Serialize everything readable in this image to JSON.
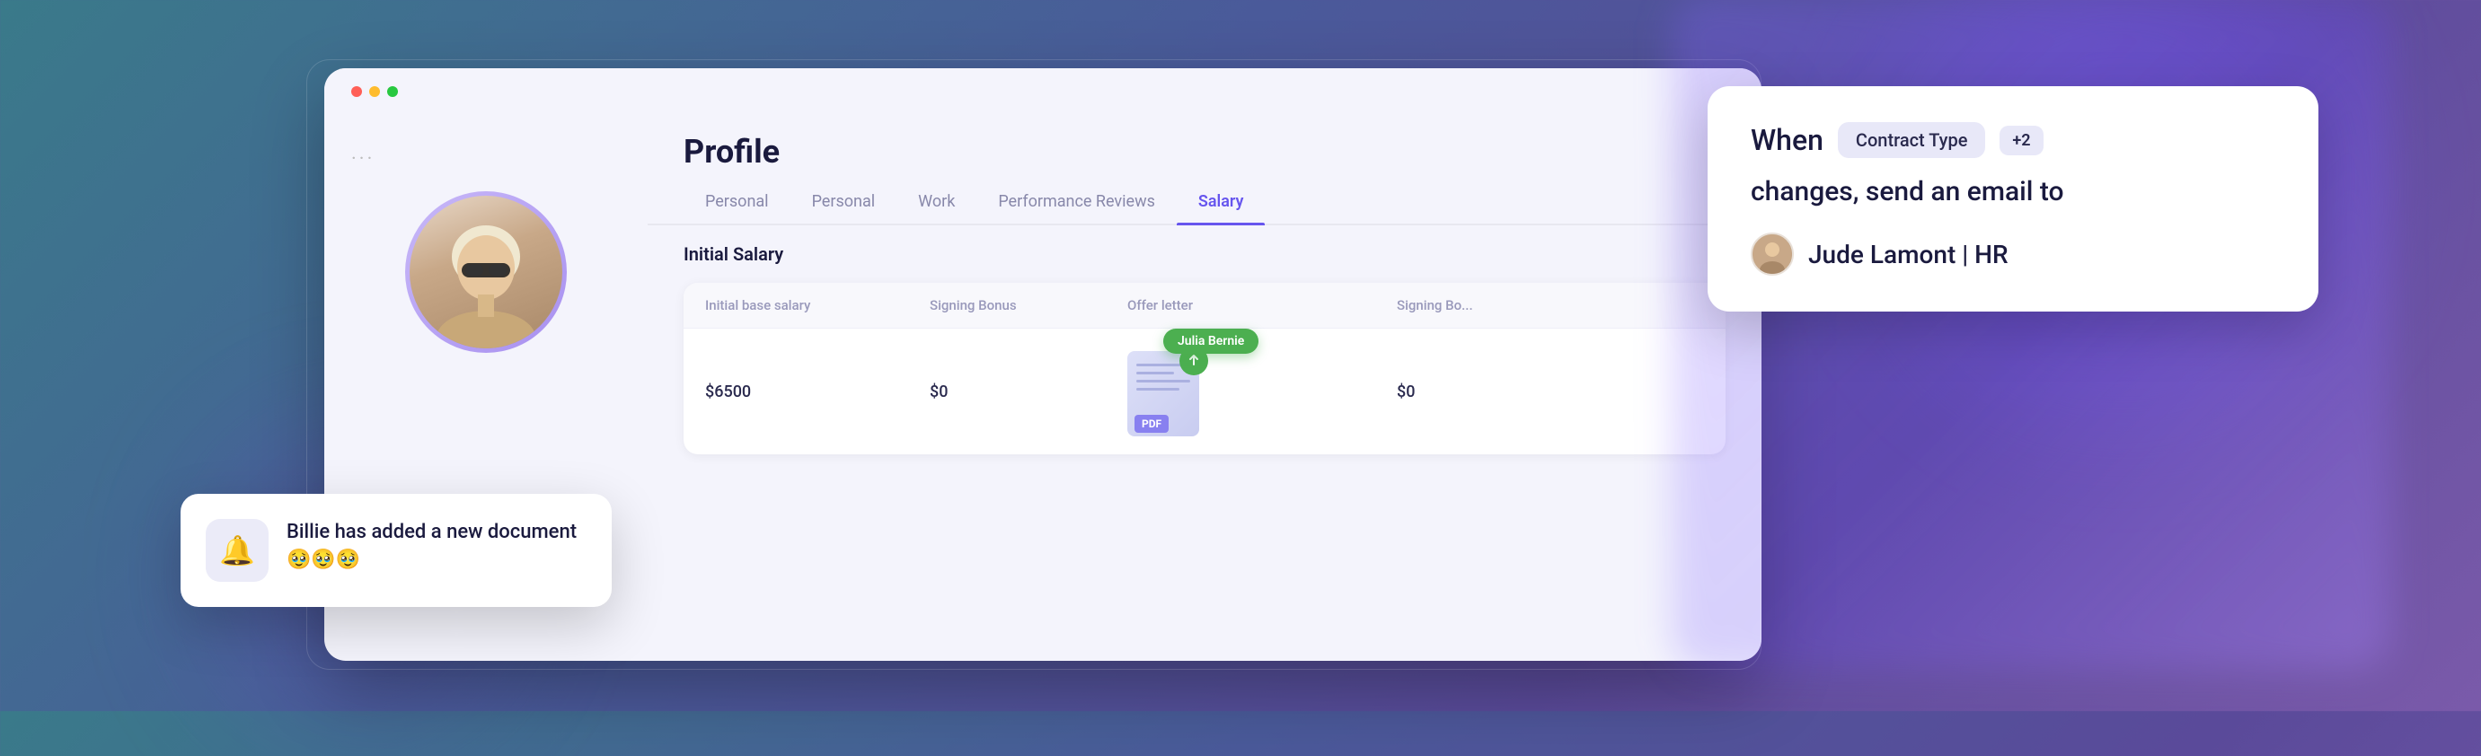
{
  "background": {
    "colors": [
      "#3a7a8a",
      "#4a5a9a",
      "#5a4a9a",
      "#7a5aaa"
    ]
  },
  "window": {
    "title": "Profile",
    "ellipsis": "...",
    "dots": [
      "red",
      "yellow",
      "green"
    ]
  },
  "profile": {
    "title": "Profile",
    "avatar_alt": "Person with sunglasses and white hair"
  },
  "tabs": [
    {
      "label": "Personal",
      "active": false
    },
    {
      "label": "Personal",
      "active": false
    },
    {
      "label": "Work",
      "active": false
    },
    {
      "label": "Performance Reviews",
      "active": false
    },
    {
      "label": "Salary",
      "active": true
    }
  ],
  "salary_section": {
    "title": "Initial Salary",
    "columns": [
      "Initial base salary",
      "Signing Bonus",
      "Offer letter",
      "Signing Bo..."
    ],
    "values": [
      "$6500",
      "$0",
      "",
      "$0"
    ]
  },
  "offer_letter": {
    "pdf_label": "PDF",
    "assignee_badge": "Julia Bernie"
  },
  "notification": {
    "icon": "🔔",
    "text": "Billie has added a new document 🥹🥹🥹"
  },
  "rule_card": {
    "when_label": "When",
    "contract_type_tag": "Contract Type",
    "plus_badge": "+2",
    "changes_text": "changes, send an email to",
    "recipient_name": "Jude Lamont | HR"
  }
}
